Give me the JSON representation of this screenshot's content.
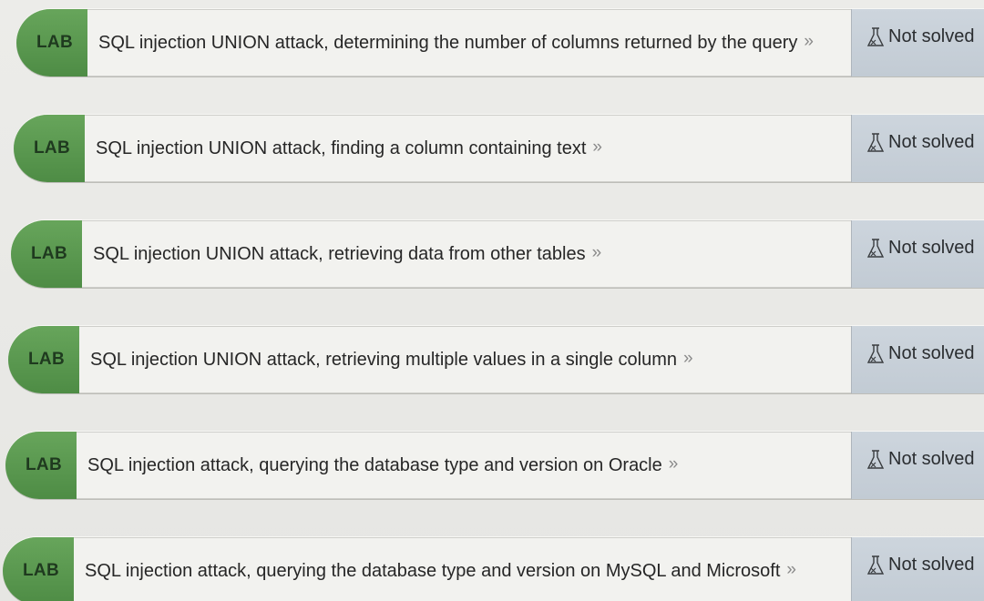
{
  "labs": [
    {
      "badge": "LAB",
      "title": "SQL injection UNION attack, determining the number of columns returned by the query",
      "chevron": "»",
      "status": "Not solved",
      "status_icon": "flask-icon"
    },
    {
      "badge": "LAB",
      "title": "SQL injection UNION attack, finding a column containing text",
      "chevron": "»",
      "status": "Not solved",
      "status_icon": "flask-icon"
    },
    {
      "badge": "LAB",
      "title": "SQL injection UNION attack, retrieving data from other tables",
      "chevron": "»",
      "status": "Not solved",
      "status_icon": "flask-icon"
    },
    {
      "badge": "LAB",
      "title": "SQL injection UNION attack, retrieving multiple values in a single column",
      "chevron": "»",
      "status": "Not solved",
      "status_icon": "flask-icon"
    },
    {
      "badge": "LAB",
      "title": "SQL injection attack, querying the database type and version on Oracle",
      "chevron": "»",
      "status": "Not solved",
      "status_icon": "flask-icon"
    },
    {
      "badge": "LAB",
      "title": "SQL injection attack, querying the database type and version on MySQL and Microsoft",
      "chevron": "»",
      "status": "Not solved",
      "status_icon": "flask-icon"
    }
  ],
  "colors": {
    "badge_green": "#5a9850",
    "status_blue_grey": "#c7d0d9",
    "title_bg": "#f2f2ef"
  }
}
